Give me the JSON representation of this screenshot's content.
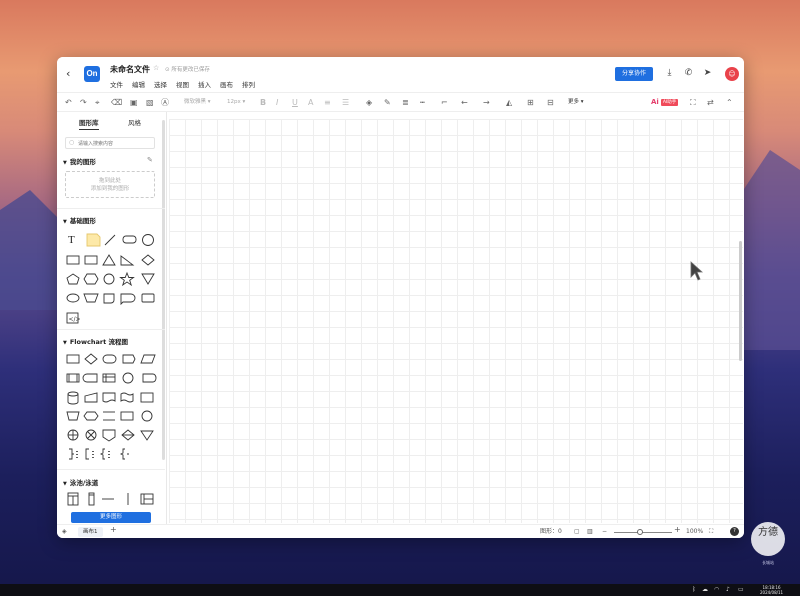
{
  "app": {
    "doc_title": "未命名文件",
    "save_status": "所有更改已保存",
    "logo_text": "On",
    "menu": [
      "文件",
      "编辑",
      "选择",
      "视图",
      "插入",
      "画布",
      "排列"
    ],
    "share_label": "分享协作"
  },
  "toolbar": {
    "font_name": "微软雅黑",
    "font_size": "12px",
    "more_label": "更多",
    "ai_logo": "Ai",
    "ai_tag": "AI助手"
  },
  "sidebar": {
    "tabs": [
      "图形库",
      "风格"
    ],
    "search_placeholder": "请输入搜索内容",
    "my_shapes_title": "我的图形",
    "dropzone_line1": "拖到此处",
    "dropzone_line2": "添加到我的图形",
    "basic_title": "基础图形",
    "flowchart_title": "Flowchart 流程图",
    "pool_title": "泳池/泳道",
    "more_shapes_label": "更多图形"
  },
  "statusbar": {
    "page_name": "画布1",
    "add_page": "+",
    "shape_count_label": "图形：0",
    "zoom_minus": "−",
    "zoom_plus": "+",
    "zoom_level": "100%",
    "help": "?"
  },
  "watermark": {
    "text": "方德",
    "sub": "长城站"
  },
  "taskbar": {
    "time": "18:18:16",
    "date": "2024/08/11"
  },
  "colors": {
    "accent": "#1f6fe0",
    "ai": "#f04a5a"
  }
}
